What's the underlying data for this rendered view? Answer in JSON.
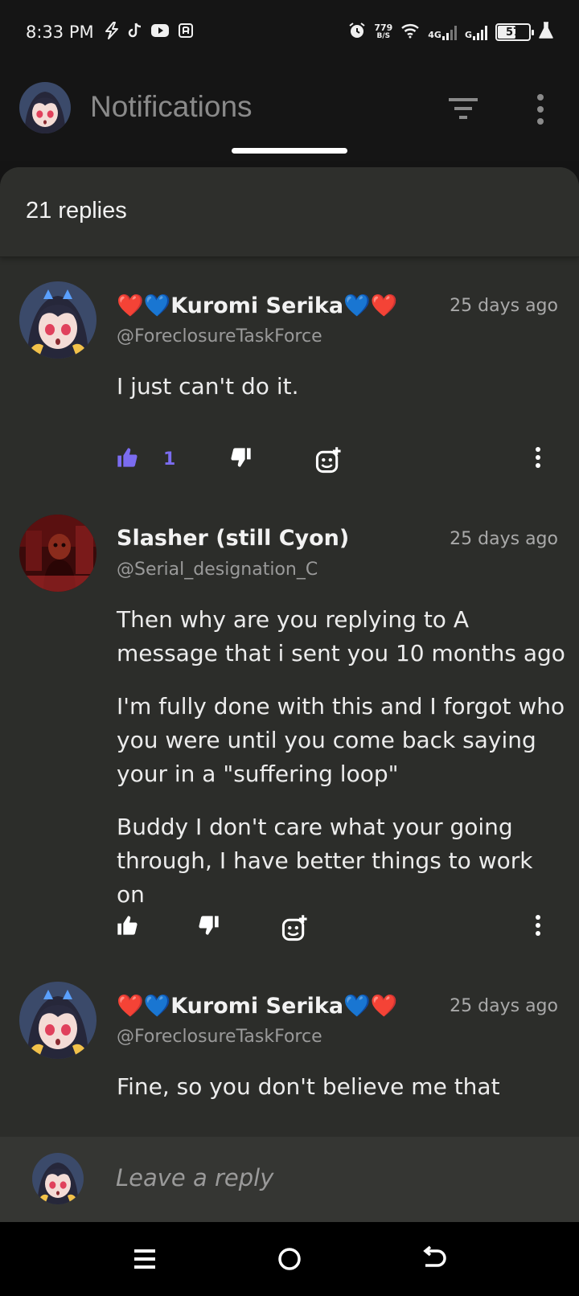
{
  "status_bar": {
    "time": "8:33 PM",
    "speed_value": "779",
    "speed_unit": "B/S",
    "net1": "4G",
    "net2": "G",
    "battery": "57",
    "battery_level": 0.57
  },
  "app_bar": {
    "title": "Notifications"
  },
  "sheet": {
    "replies_count": "21 replies"
  },
  "comments": [
    {
      "name": "❤️💙Kuromi Serika💙❤️",
      "handle": "@ForeclosureTaskForce",
      "time": "25 days ago",
      "paragraphs": [
        "I just can't do it."
      ],
      "likes": "1",
      "liked": true
    },
    {
      "name": "Slasher (still Cyon)",
      "handle": "@Serial_designation_C",
      "time": "25 days ago",
      "paragraphs": [
        "Then why are you replying to A message that i sent you 10 months ago",
        "I'm fully done with this and I forgot who you were until you come back saying your in a \"suffering loop\"",
        "Buddy I don't care what your going through, I have better things to work on"
      ],
      "likes": "",
      "liked": false
    },
    {
      "name": "❤️💙Kuromi Serika💙❤️",
      "handle": "@ForeclosureTaskForce",
      "time": "25 days ago",
      "paragraphs": [
        "Fine, so you don't believe me that"
      ],
      "likes": "",
      "liked": false
    }
  ],
  "reply_bar": {
    "placeholder": "Leave a reply"
  },
  "colors": {
    "accent": "#7b6cf0",
    "sheet_bg": "#2c2d2a",
    "text": "#ececec"
  }
}
